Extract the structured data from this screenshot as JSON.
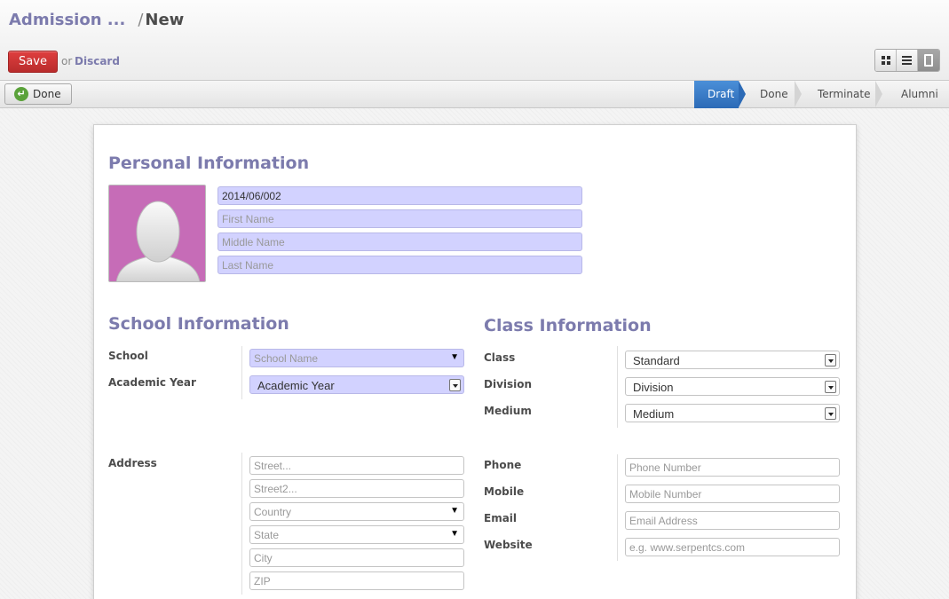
{
  "header": {
    "breadcrumb_parent": "Admission ...",
    "breadcrumb_separator": "/",
    "breadcrumb_current": "New",
    "save_label": "Save",
    "or_text": "or",
    "discard_label": "Discard",
    "view_switch": [
      "kanban-icon",
      "list-icon",
      "form-icon"
    ]
  },
  "statusbar": {
    "done_button": "Done",
    "stages": [
      {
        "label": "Draft",
        "active": true
      },
      {
        "label": "Done",
        "active": false
      },
      {
        "label": "Terminate",
        "active": false
      },
      {
        "label": "Alumni",
        "active": false
      }
    ]
  },
  "personal": {
    "title": "Personal Information",
    "admission_no": "2014/06/002",
    "first_name_placeholder": "First Name",
    "middle_name_placeholder": "Middle Name",
    "last_name_placeholder": "Last Name",
    "avatar_color": "#c66cb7"
  },
  "school": {
    "title": "School Information",
    "school_label": "School",
    "school_placeholder": "School Name",
    "year_label": "Academic Year",
    "year_value": "Academic Year"
  },
  "class_info": {
    "title": "Class Information",
    "class_label": "Class",
    "class_value": "Standard",
    "division_label": "Division",
    "division_value": "Division",
    "medium_label": "Medium",
    "medium_value": "Medium"
  },
  "address": {
    "label": "Address",
    "street_placeholder": "Street...",
    "street2_placeholder": "Street2...",
    "country_placeholder": "Country",
    "state_placeholder": "State",
    "city_placeholder": "City",
    "zip_placeholder": "ZIP"
  },
  "contact": {
    "phone_label": "Phone",
    "phone_placeholder": "Phone Number",
    "mobile_label": "Mobile",
    "mobile_placeholder": "Mobile Number",
    "email_label": "Email",
    "email_placeholder": "Email Address",
    "website_label": "Website",
    "website_placeholder": "e.g. www.serpentcs.com"
  },
  "colors": {
    "accent": "#7c7bad",
    "save": "#c9302c",
    "required_field": "#d2d2ff",
    "active_stage": "#3d7cc9"
  }
}
